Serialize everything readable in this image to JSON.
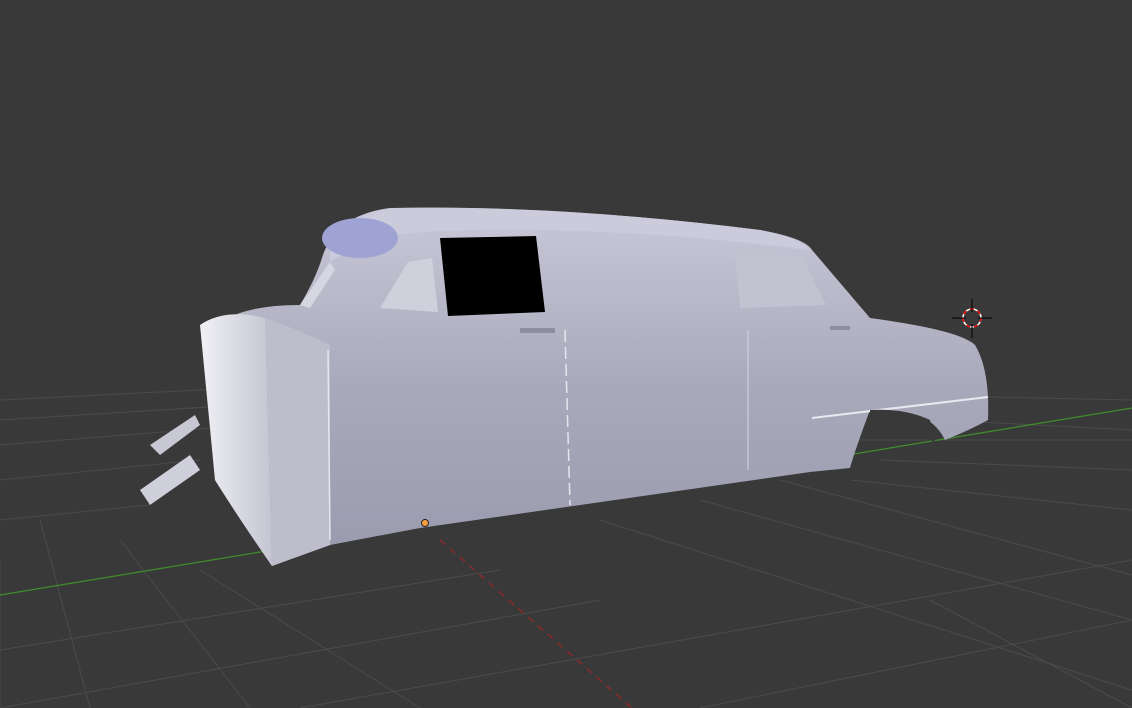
{
  "viewport": {
    "background_color": "#393939",
    "grid_color": "#4a4a4a",
    "x_axis_color": "#8b2a2a",
    "y_axis_color": "#3f8f2a",
    "model_color": "#b6b6c8",
    "origin_color": "#f0a040",
    "cursor_icon": "3d-cursor-icon"
  }
}
